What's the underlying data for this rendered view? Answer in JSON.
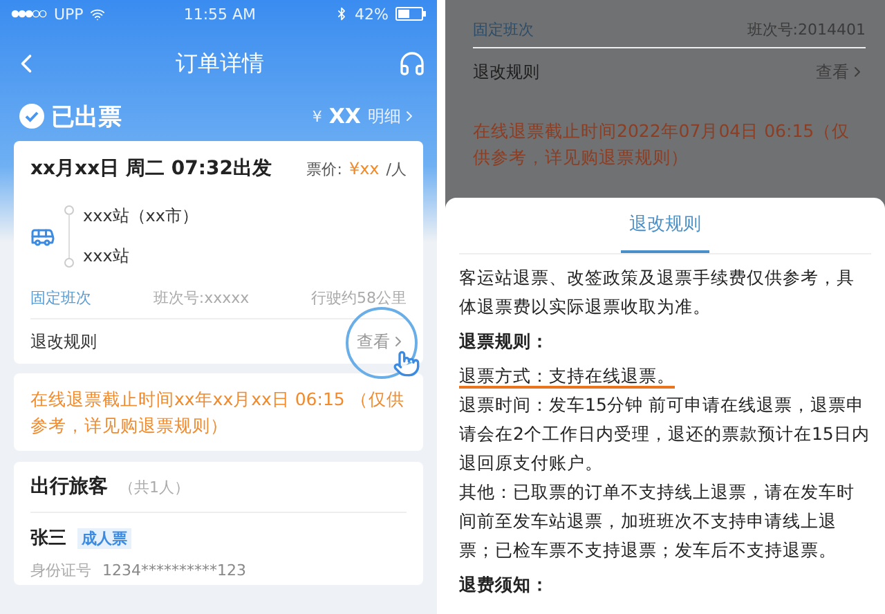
{
  "left_screen": {
    "status_bar": {
      "carrier": "UPP",
      "time": "11:55 AM",
      "battery": "42%"
    },
    "nav": {
      "title": "订单详情"
    },
    "order_status": {
      "label": "已出票",
      "currency": "¥",
      "amount": "XX",
      "detail_link": "明细"
    },
    "trip": {
      "departure": "xx月xx日  周二 07:32出发",
      "price_label": "票价:",
      "price": "¥xx",
      "price_unit": "/人",
      "stops": [
        "xxx站（xx市）",
        "xxx站"
      ],
      "schedule_type": "固定班次",
      "schedule_no": "班次号:xxxxx",
      "distance": "行驶约58公里",
      "rules_label": "退改规则",
      "rules_link": "查看"
    },
    "notice": "在线退票截止时间xx年xx月xx日 06:15 （仅供参考，详见购退票规则）",
    "passengers": {
      "title": "出行旅客",
      "count": "（共1人）",
      "items": [
        {
          "name": "张三",
          "ticket_type": "成人票",
          "id_label": "身份证号",
          "id_number": "1234**********123"
        }
      ]
    }
  },
  "right_screen": {
    "background": {
      "schedule_type": "固定班次",
      "schedule_no": "班次号:2014401",
      "rules_label": "退改规则",
      "rules_link": "查看",
      "notice": "在线退票截止时间2022年07月04日 06:15（仅供参考，详见购退票规则）"
    },
    "sheet": {
      "title": "退改规则",
      "intro": "客运站退票、改签政策及退票手续费仅供参考，具体退票费以实际退票收取为准。",
      "sections": [
        {
          "heading": "退票规则：",
          "paragraphs": [
            {
              "text": "退票方式：支持在线退票。",
              "highlighted": true
            },
            {
              "text": "退票时间：发车15分钟 前可申请在线退票，退票申请会在2个工作日内受理，退还的票款预计在15日内退回原支付账户。",
              "highlighted": false
            },
            {
              "text": "其他：已取票的订单不支持线上退票，请在发车时间前至发车站退票，加班班次不支持申请线上退票；已检车票不支持退票；发车后不支持退票。",
              "highlighted": false
            }
          ]
        },
        {
          "heading": "退费须知："
        }
      ]
    }
  }
}
